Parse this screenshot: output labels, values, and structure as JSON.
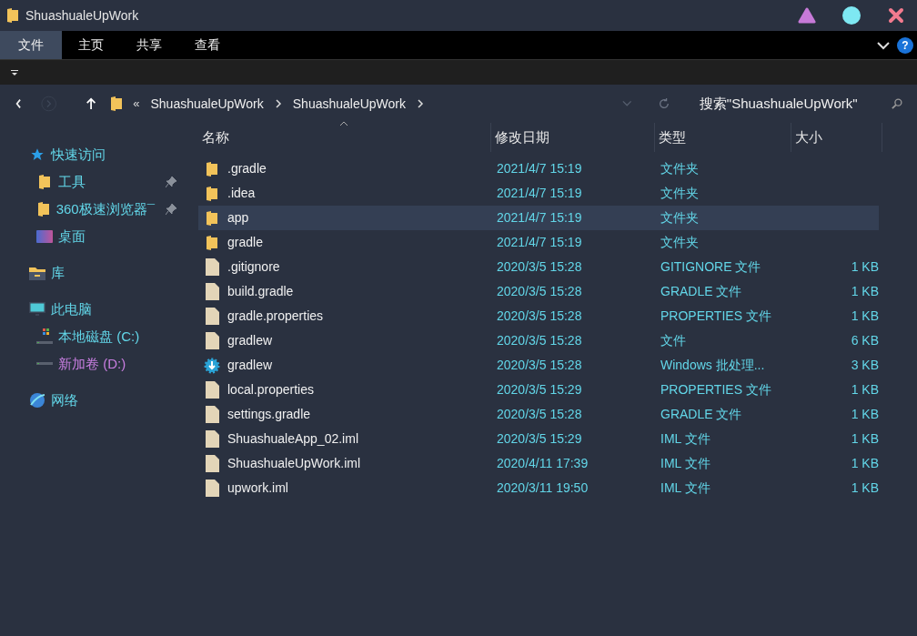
{
  "window": {
    "title": "ShuashualeUpWork"
  },
  "ribbon_tabs": [
    {
      "label": "文件",
      "selected": true
    },
    {
      "label": "主页",
      "selected": false
    },
    {
      "label": "共享",
      "selected": false
    },
    {
      "label": "查看",
      "selected": false
    }
  ],
  "help": "?",
  "address": {
    "overflow": "«",
    "path": [
      "ShuashualeUpWork",
      "ShuashualeUpWork"
    ]
  },
  "search": {
    "placeholder": "搜索\"ShuashualeUpWork\""
  },
  "nav": [
    {
      "kind": "star",
      "label": "快速访问",
      "children": [
        {
          "kind": "folder",
          "label": "工具",
          "pinned": true
        },
        {
          "kind": "folder",
          "label": "360极速浏览器¯",
          "pinned": true
        },
        {
          "kind": "desktop",
          "label": "桌面",
          "pinned": false
        }
      ]
    },
    {
      "kind": "library",
      "label": "库"
    },
    {
      "kind": "pc",
      "label": "此电脑",
      "children": [
        {
          "kind": "drive-c",
          "label": "本地磁盘 (C:)",
          "pinned": false
        },
        {
          "kind": "drive",
          "label": "新加卷 (D:)",
          "pinned": false,
          "color": "#c87ee0"
        }
      ]
    },
    {
      "kind": "network",
      "label": "网络"
    }
  ],
  "table": {
    "columns": [
      "名称",
      "修改日期",
      "类型",
      "大小"
    ],
    "rows": [
      {
        "kind": "folder",
        "name": ".gradle",
        "date": "2021/4/7 15:19",
        "type": "文件夹",
        "size": "",
        "selected": false
      },
      {
        "kind": "folder",
        "name": ".idea",
        "date": "2021/4/7 15:19",
        "type": "文件夹",
        "size": "",
        "selected": false
      },
      {
        "kind": "folder",
        "name": "app",
        "date": "2021/4/7 15:19",
        "type": "文件夹",
        "size": "",
        "selected": true
      },
      {
        "kind": "folder",
        "name": "gradle",
        "date": "2021/4/7 15:19",
        "type": "文件夹",
        "size": "",
        "selected": false
      },
      {
        "kind": "file",
        "name": ".gitignore",
        "date": "2020/3/5 15:28",
        "type": "GITIGNORE 文件",
        "size": "1 KB",
        "selected": false
      },
      {
        "kind": "file",
        "name": "build.gradle",
        "date": "2020/3/5 15:28",
        "type": "GRADLE 文件",
        "size": "1 KB",
        "selected": false
      },
      {
        "kind": "file",
        "name": "gradle.properties",
        "date": "2020/3/5 15:28",
        "type": "PROPERTIES 文件",
        "size": "1 KB",
        "selected": false
      },
      {
        "kind": "file",
        "name": "gradlew",
        "date": "2020/3/5 15:28",
        "type": "文件",
        "size": "6 KB",
        "selected": false
      },
      {
        "kind": "batch",
        "name": "gradlew",
        "date": "2020/3/5 15:28",
        "type": "Windows 批处理...",
        "size": "3 KB",
        "selected": false
      },
      {
        "kind": "file",
        "name": "local.properties",
        "date": "2020/3/5 15:29",
        "type": "PROPERTIES 文件",
        "size": "1 KB",
        "selected": false
      },
      {
        "kind": "file",
        "name": "settings.gradle",
        "date": "2020/3/5 15:28",
        "type": "GRADLE 文件",
        "size": "1 KB",
        "selected": false
      },
      {
        "kind": "file",
        "name": "ShuashualeApp_02.iml",
        "date": "2020/3/5 15:29",
        "type": "IML 文件",
        "size": "1 KB",
        "selected": false
      },
      {
        "kind": "file",
        "name": "ShuashualeUpWork.iml",
        "date": "2020/4/11 17:39",
        "type": "IML 文件",
        "size": "1 KB",
        "selected": false
      },
      {
        "kind": "file",
        "name": "upwork.iml",
        "date": "2020/3/11 19:50",
        "type": "IML 文件",
        "size": "1 KB",
        "selected": false
      }
    ]
  }
}
